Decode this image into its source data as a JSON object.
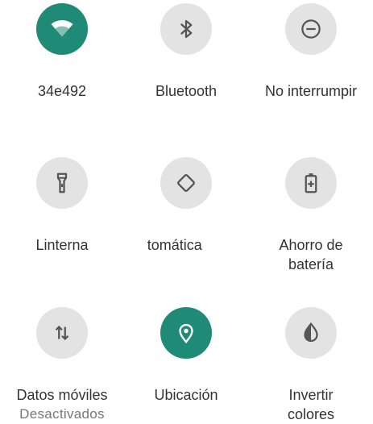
{
  "tiles": {
    "wifi": {
      "label": "34e492",
      "icon": "wifi-icon",
      "active": true
    },
    "bluetooth": {
      "label": "Bluetooth",
      "icon": "bluetooth-icon",
      "active": false
    },
    "dnd": {
      "label": "No interrumpir",
      "icon": "do-not-disturb-icon",
      "active": false
    },
    "flashlight": {
      "label": "Linterna",
      "icon": "flashlight-icon",
      "active": false
    },
    "autorotate": {
      "label": " tomática",
      "icon": "auto-rotate-icon",
      "active": false
    },
    "battery_saver": {
      "label_line1": "Ahorro de",
      "label_line2": "batería",
      "icon": "battery-saver-icon",
      "active": false
    },
    "mobile_data": {
      "label": "Datos móviles",
      "status": "Desactivados",
      "icon": "mobile-data-icon",
      "active": false
    },
    "location": {
      "label": "Ubicación",
      "icon": "location-icon",
      "active": true
    },
    "invert_colors": {
      "label_line1": "Invertir",
      "label_line2": "colores",
      "icon": "invert-colors-icon",
      "active": false
    }
  },
  "colors": {
    "accent": "#1f8a76",
    "inactive": "#e3e3e3",
    "icon_dark": "#555555"
  }
}
